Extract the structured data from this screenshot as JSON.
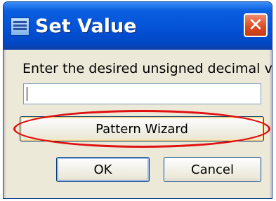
{
  "window": {
    "title": "Set Value",
    "app_icon": "app-window-icon",
    "close_glyph": "✕"
  },
  "dialog": {
    "prompt": "Enter the desired unsigned decimal valu",
    "input_value": ""
  },
  "buttons": {
    "pattern_wizard": "Pattern Wizard",
    "ok": "OK",
    "cancel": "Cancel"
  },
  "colors": {
    "titlebar": "#0552d6",
    "close_button": "#d94b22",
    "highlight_ring": "#e01010",
    "dialog_background": "#ece9d8"
  }
}
